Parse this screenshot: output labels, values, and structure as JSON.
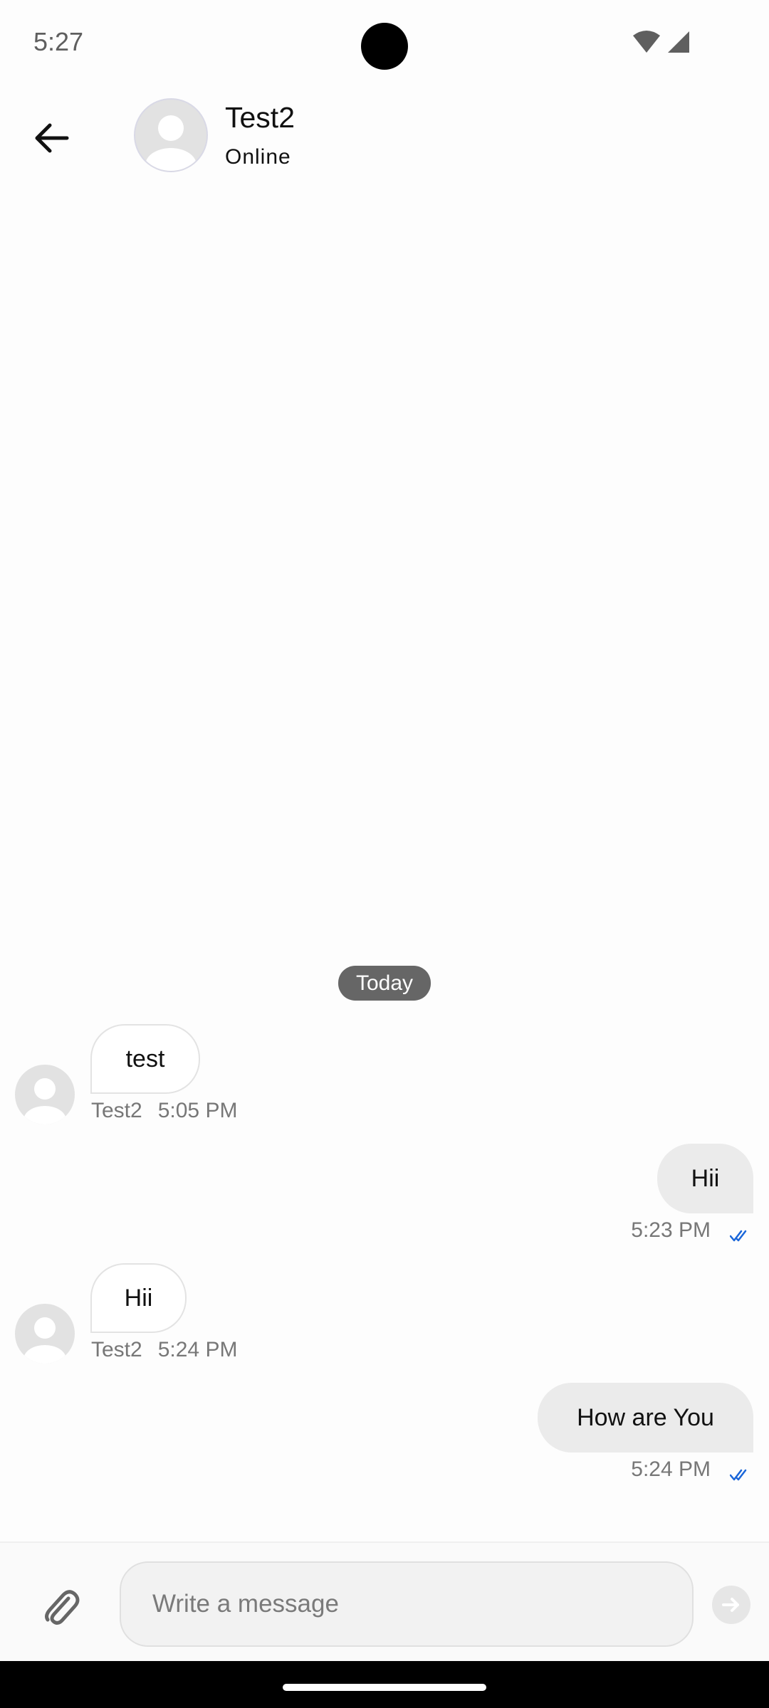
{
  "status_bar": {
    "time": "5:27"
  },
  "header": {
    "contact_name": "Test2",
    "contact_status": "Online"
  },
  "conversation": {
    "date_separator": "Today",
    "messages": [
      {
        "direction": "incoming",
        "text": "test",
        "sender": "Test2",
        "time": "5:05 PM"
      },
      {
        "direction": "outgoing",
        "text": "Hii",
        "time": "5:23 PM",
        "read": true
      },
      {
        "direction": "incoming",
        "text": "Hii",
        "sender": "Test2",
        "time": "5:24 PM"
      },
      {
        "direction": "outgoing",
        "text": "How are You",
        "time": "5:24 PM",
        "read": true
      }
    ]
  },
  "composer": {
    "placeholder": "Write a message",
    "value": ""
  },
  "colors": {
    "read_receipt": "#1a66d9",
    "date_chip": "#666666",
    "outgoing_bubble": "#ebebeb"
  },
  "icons": [
    "back-arrow-icon",
    "avatar-icon",
    "wifi-icon",
    "signal-icon",
    "double-check-icon",
    "paperclip-icon",
    "send-arrow-icon"
  ]
}
